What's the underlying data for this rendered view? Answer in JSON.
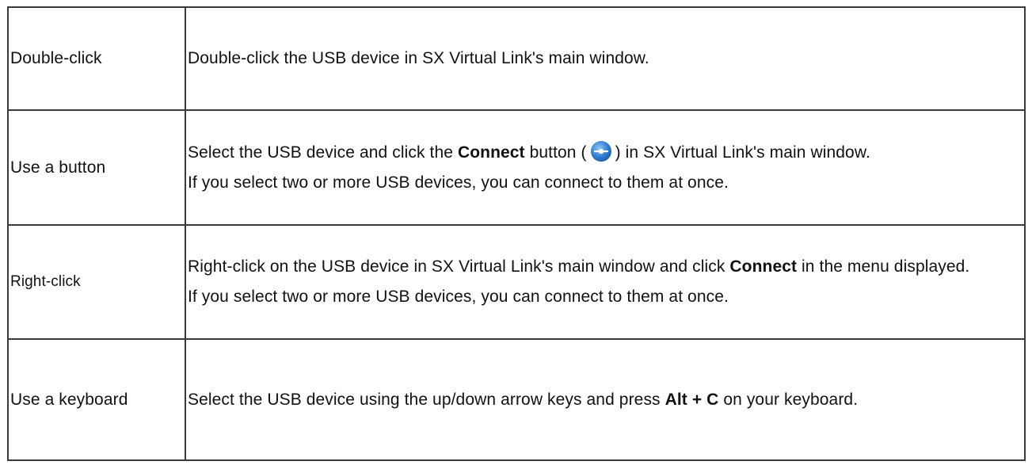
{
  "rows": [
    {
      "method": "Double-click",
      "desc": {
        "text1": "Double-click the USB device in SX Virtual Link's main window."
      }
    },
    {
      "method": "Use a button",
      "desc": {
        "pre": "Select the USB device and click the ",
        "bold": "Connect",
        "mid": " button (",
        "post": ") in SX Virtual Link's main window.",
        "line2": "If you select two or more USB devices, you can connect to them at once.",
        "icon": "connect-icon"
      }
    },
    {
      "method": "Right-click",
      "desc": {
        "pre": "Right-click on the USB device in SX Virtual Link's main window and click ",
        "bold": "Connect",
        "post": " in the menu displayed.",
        "line2": "If you select two or more USB devices, you can connect to them at once."
      }
    },
    {
      "method": "Use a keyboard",
      "desc": {
        "pre": "Select the USB device using the up/down arrow keys and press ",
        "bold": "Alt + C",
        "post": " on your keyboard."
      }
    }
  ],
  "colors": {
    "border": "#3a3a3a",
    "text": "#111111",
    "icon_blue": "#2f7fd6"
  }
}
